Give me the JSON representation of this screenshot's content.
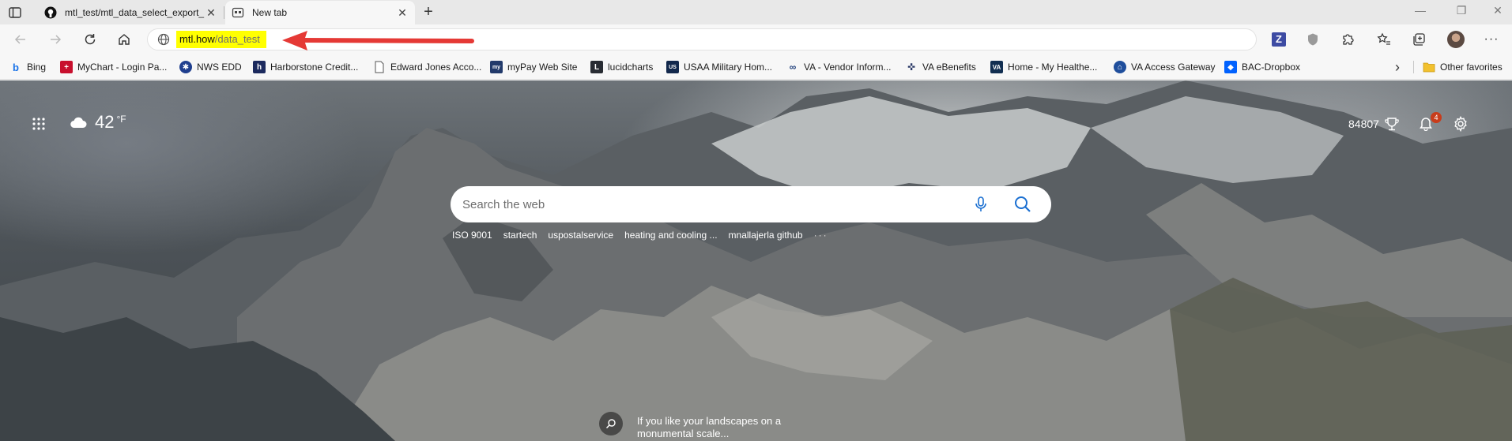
{
  "tabs": [
    {
      "title": "mtl_test/mtl_data_select_export_",
      "favicon": "github-icon",
      "active": false
    },
    {
      "title": "New tab",
      "favicon": "newtab-icon",
      "active": true
    }
  ],
  "address": {
    "host": "mtl.how",
    "path": "/data_test"
  },
  "favorites": [
    {
      "label": "Bing",
      "icon": "bing-icon",
      "color": "#1a73e8"
    },
    {
      "label": "MyChart - Login Pa...",
      "icon": "mychart-icon",
      "color": "#c8102e"
    },
    {
      "label": "NWS EDD",
      "icon": "nws-icon",
      "color": "#1f3f8f"
    },
    {
      "label": "Harborstone Credit...",
      "icon": "harborstone-icon",
      "color": "#1c2a5e"
    },
    {
      "label": "Edward Jones Acco...",
      "icon": "document-icon",
      "color": "#666666"
    },
    {
      "label": "myPay Web Site",
      "icon": "mypay-icon",
      "color": "#223a6b"
    },
    {
      "label": "lucidcharts",
      "icon": "lucid-icon",
      "color": "#282c33"
    },
    {
      "label": "USAA Military Hom...",
      "icon": "usaa-icon",
      "color": "#12284c"
    },
    {
      "label": "VA - Vendor Inform...",
      "icon": "va-vendor-icon",
      "color": "#1c3d7a"
    },
    {
      "label": "VA eBenefits",
      "icon": "ebenefits-icon",
      "color": "#2b3a67"
    },
    {
      "label": "Home - My Healthe...",
      "icon": "va-icon",
      "color": "#112e51"
    },
    {
      "label": "VA Access Gateway",
      "icon": "gateway-icon",
      "color": "#1f4e9c"
    },
    {
      "label": "BAC-Dropbox",
      "icon": "dropbox-icon",
      "color": "#0061fe"
    }
  ],
  "favorites_overflow": "›",
  "other_favorites": "Other favorites",
  "weather": {
    "temp": "42",
    "unit": "°F",
    "icon": "cloud-icon"
  },
  "rewards_points": "84807",
  "notifications_count": "4",
  "search": {
    "placeholder": "Search the web"
  },
  "trending": [
    "ISO 9001",
    "startech",
    "uspostalservice",
    "heating and cooling ...",
    "mnallajerla github"
  ],
  "trending_more": "···",
  "caption": "If you like your landscapes on a monumental scale...",
  "annotation": {
    "color": "#e53935"
  }
}
